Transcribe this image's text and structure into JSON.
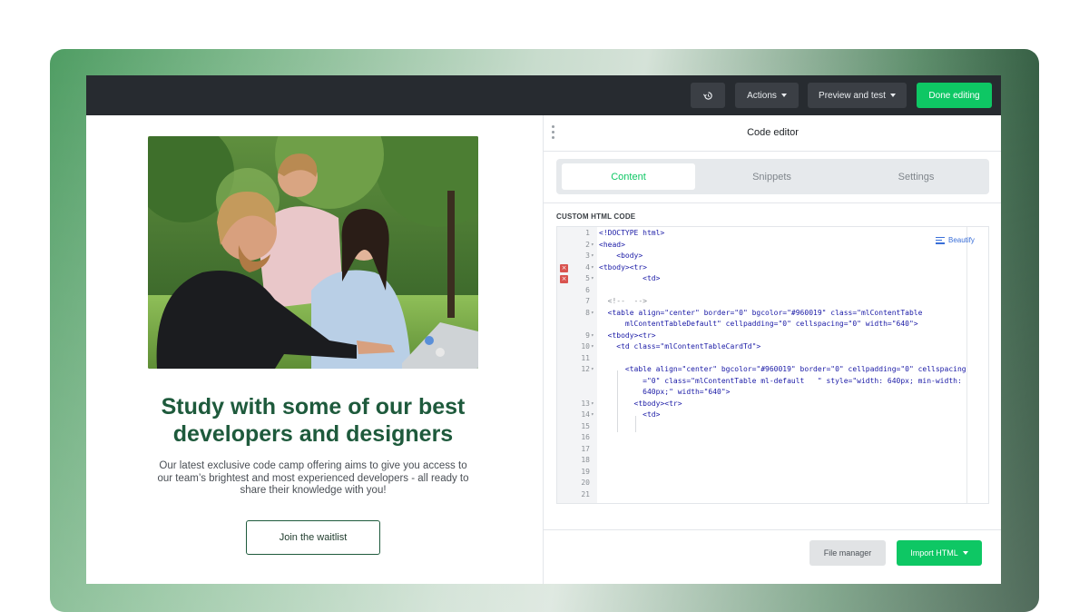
{
  "toolbar": {
    "history_icon": "history-icon",
    "actions_label": "Actions",
    "preview_label": "Preview and test",
    "done_label": "Done editing"
  },
  "email": {
    "image_icon": "photo-three-people-laptop",
    "headline_line1": "Study with some of our best",
    "headline_line2": "developers and designers",
    "body_line1": "Our latest exclusive code camp offering aims to give you access to",
    "body_line2": "our team’s brightest and most experienced developers - all ready to",
    "body_line3": "share their knowledge with you!",
    "cta_label": "Join the waitlist"
  },
  "panel": {
    "title": "Code editor",
    "tabs": [
      {
        "label": "Content",
        "active": true
      },
      {
        "label": "Snippets",
        "active": false
      },
      {
        "label": "Settings",
        "active": false
      }
    ],
    "code_label": "CUSTOM HTML CODE",
    "beautify_label": "Beautify",
    "file_manager_label": "File manager",
    "import_label": "Import HTML"
  },
  "code_lines": [
    {
      "n": "1",
      "text": "<!DOCTYPE html>"
    },
    {
      "n": "2",
      "text": "<head>"
    },
    {
      "n": "3",
      "text": "    <body>"
    },
    {
      "n": "4",
      "text": "<tbody><tr>"
    },
    {
      "n": "5",
      "text": "          <td>"
    },
    {
      "n": "6",
      "text": ""
    },
    {
      "n": "7",
      "text": "  <!--  -->"
    },
    {
      "n": "8",
      "text": "  <table align=\"center\" border=\"0\" bgcolor=\"#960019\" class=\"mlContentTable"
    },
    {
      "n": "",
      "text": "      mlContentTableDefault\" cellpadding=\"0\" cellspacing=\"0\" width=\"640\">"
    },
    {
      "n": "9",
      "text": "  <tbody><tr>"
    },
    {
      "n": "10",
      "text": "    <td class=\"mlContentTableCardTd\">"
    },
    {
      "n": "11",
      "text": ""
    },
    {
      "n": "12",
      "text": "      <table align=\"center\" bgcolor=\"#960019\" border=\"0\" cellpadding=\"0\" cellspacing"
    },
    {
      "n": "",
      "text": "          =\"0\" class=\"mlContentTable ml-default   \" style=\"width: 640px; min-width:"
    },
    {
      "n": "",
      "text": "          640px;\" width=\"640\">"
    },
    {
      "n": "13",
      "text": "        <tbody><tr>"
    },
    {
      "n": "14",
      "text": "          <td>"
    },
    {
      "n": "15",
      "text": ""
    },
    {
      "n": "16",
      "text": ""
    },
    {
      "n": "17",
      "text": ""
    },
    {
      "n": "18",
      "text": ""
    },
    {
      "n": "19",
      "text": ""
    },
    {
      "n": "20",
      "text": ""
    },
    {
      "n": "21",
      "text": ""
    }
  ],
  "colors": {
    "accent": "#0ec764",
    "headline": "#1e5a3c",
    "topbar": "#272b30"
  }
}
